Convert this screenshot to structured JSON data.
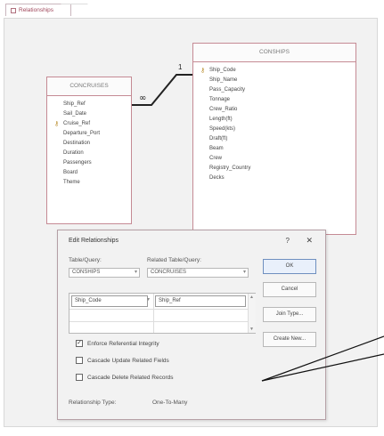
{
  "tab": {
    "label": "Relationships"
  },
  "tables": {
    "left": {
      "title": "CONCRUISES",
      "fields": [
        {
          "name": "Ship_Ref",
          "key": false
        },
        {
          "name": "Sail_Date",
          "key": false
        },
        {
          "name": "Cruise_Ref",
          "key": true
        },
        {
          "name": "Departure_Port",
          "key": false
        },
        {
          "name": "Destination",
          "key": false
        },
        {
          "name": "Duration",
          "key": false
        },
        {
          "name": "Passengers",
          "key": false
        },
        {
          "name": "Board",
          "key": false
        },
        {
          "name": "Theme",
          "key": false
        }
      ]
    },
    "right": {
      "title": "CONSHIPS",
      "fields": [
        {
          "name": "Ship_Code",
          "key": true
        },
        {
          "name": "Ship_Name",
          "key": false
        },
        {
          "name": "Pass_Capacity",
          "key": false
        },
        {
          "name": "Tonnage",
          "key": false
        },
        {
          "name": "Crew_Ratio",
          "key": false
        },
        {
          "name": "Length(ft)",
          "key": false
        },
        {
          "name": "Speed(kts)",
          "key": false
        },
        {
          "name": "Draft(ft)",
          "key": false
        },
        {
          "name": "Beam",
          "key": false
        },
        {
          "name": "Crew",
          "key": false
        },
        {
          "name": "Registry_Country",
          "key": false
        },
        {
          "name": "Decks",
          "key": false
        }
      ]
    }
  },
  "relationship_line": {
    "one_symbol": "1",
    "many_symbol": "∞"
  },
  "dialog": {
    "title": "Edit Relationships",
    "help": "?",
    "close": "✕",
    "table_label": "Table/Query:",
    "related_label": "Related Table/Query:",
    "table_value": "CONSHIPS",
    "related_value": "CONCRUISES",
    "grid_left": "Ship_Code",
    "grid_right": "Ship_Ref",
    "buttons": {
      "ok": "OK",
      "cancel": "Cancel",
      "join_type": "Join Type...",
      "create_new": "Create New..."
    },
    "checkboxes": [
      {
        "label": "Enforce Referential Integrity",
        "checked": true
      },
      {
        "label": "Cascade Update Related Fields",
        "checked": false
      },
      {
        "label": "Cascade Delete Related Records",
        "checked": false
      }
    ],
    "relationship_type_label": "Relationship Type:",
    "relationship_type_value": "One-To-Many"
  }
}
